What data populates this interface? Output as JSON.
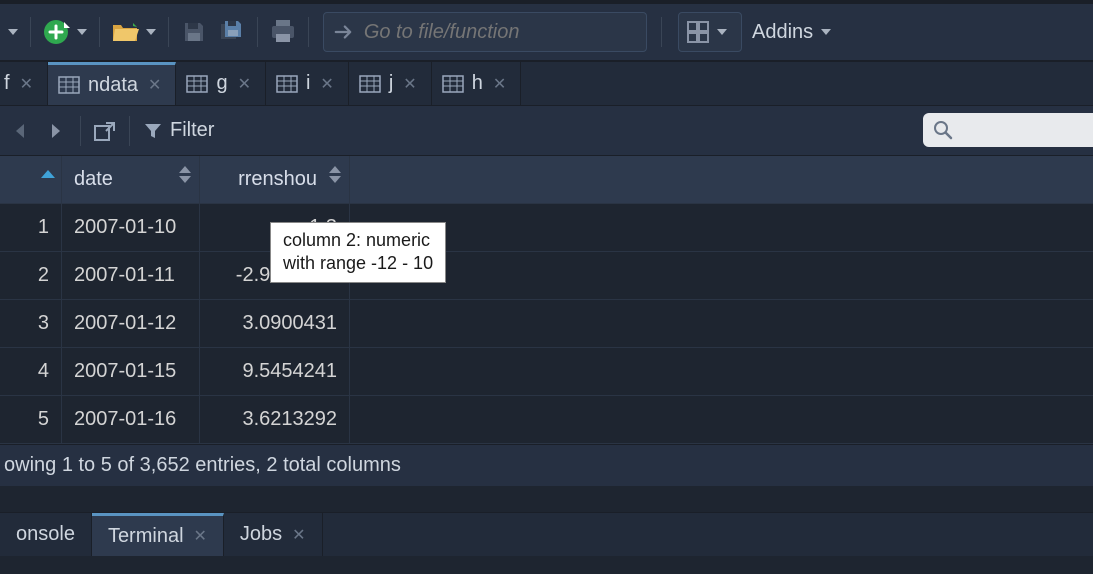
{
  "toolbar": {
    "goto_placeholder": "Go to file/function",
    "addins_label": "Addins"
  },
  "tabs": [
    {
      "label": "f"
    },
    {
      "label": "ndata"
    },
    {
      "label": "g"
    },
    {
      "label": "i"
    },
    {
      "label": "j"
    },
    {
      "label": "h"
    }
  ],
  "viewer": {
    "filter_label": "Filter"
  },
  "table": {
    "columns": [
      "date",
      "rrenshou"
    ],
    "rows": [
      {
        "idx": "1",
        "date": "2007-01-10",
        "val": "1.3"
      },
      {
        "idx": "2",
        "date": "2007-01-11",
        "val": "-2.9949107"
      },
      {
        "idx": "3",
        "date": "2007-01-12",
        "val": "3.0900431"
      },
      {
        "idx": "4",
        "date": "2007-01-15",
        "val": "9.5454241"
      },
      {
        "idx": "5",
        "date": "2007-01-16",
        "val": "3.6213292"
      }
    ]
  },
  "tooltip": {
    "line1": "column 2: numeric",
    "line2": "with range -12 - 10"
  },
  "status": "owing 1 to 5 of 3,652 entries, 2 total columns",
  "bottom_tabs": {
    "console": "onsole",
    "terminal": "Terminal",
    "jobs": "Jobs"
  }
}
